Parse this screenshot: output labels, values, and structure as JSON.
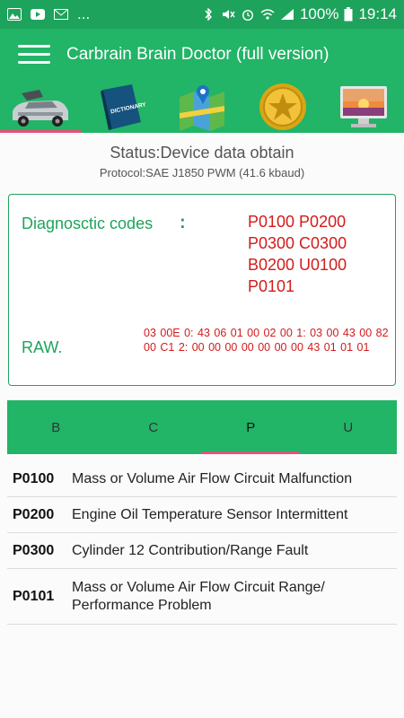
{
  "status_bar": {
    "dots": "...",
    "battery": "100%",
    "time": "19:14"
  },
  "app_bar": {
    "title": "Carbrain Brain Doctor (full version)"
  },
  "icon_tabs": [
    {
      "name": "car-icon"
    },
    {
      "name": "dictionary-icon"
    },
    {
      "name": "map-icon"
    },
    {
      "name": "star-coin-icon"
    },
    {
      "name": "monitor-icon"
    }
  ],
  "dictionary_label": "DICTIONARY",
  "status": {
    "line": "Status:Device data obtain",
    "protocol": "Protocol:SAE J1850 PWM (41.6 kbaud)"
  },
  "diagnostic": {
    "label": "Diagnosctic codes",
    "colon": ":",
    "codes_line1": "P0100 P0200",
    "codes_line2": "P0300 C0300",
    "codes_line3": "B0200 U0100",
    "codes_line4": "P0101",
    "raw_label": "RAW.",
    "raw_data": "03 00E  0: 43 06 01 00 02 00  1: 03 00 43 00 82 00 C1  2: 00 00 00 00 00 00 00  43 01 01 01"
  },
  "letter_tabs": {
    "b": "B",
    "c": "C",
    "p": "P",
    "u": "U"
  },
  "code_list": [
    {
      "code": "P0100",
      "desc": "Mass or Volume Air Flow Circuit Malfunction"
    },
    {
      "code": "P0200",
      "desc": "Engine Oil Temperature Sensor Intermittent"
    },
    {
      "code": "P0300",
      "desc": "Cylinder 12 Contribution/Range Fault"
    },
    {
      "code": "P0101",
      "desc": "Mass or Volume Air Flow Circuit Range/ Performance Problem"
    }
  ],
  "colors": {
    "primary": "#22b467",
    "accent": "#e0527d",
    "code_red": "#d21b1b"
  }
}
